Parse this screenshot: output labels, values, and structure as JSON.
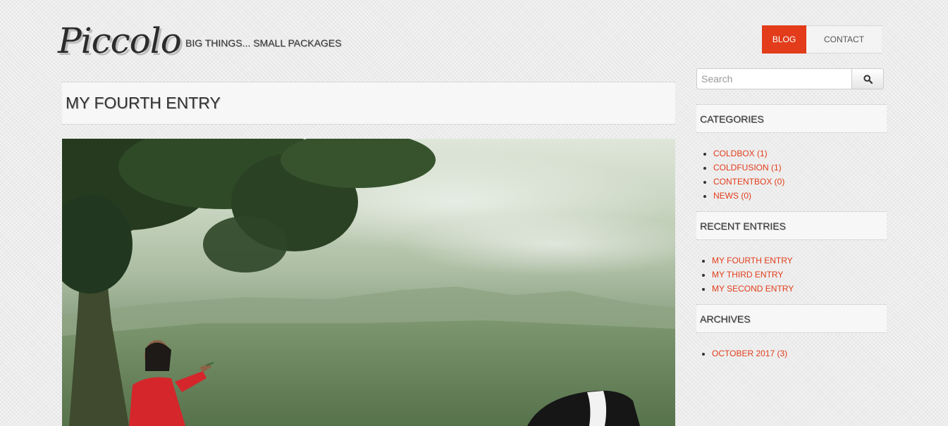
{
  "site": {
    "logo": "Piccolo",
    "tagline": "BIG THINGS... SMALL PACKAGES"
  },
  "nav": {
    "items": [
      {
        "label": "BLOG",
        "active": true
      },
      {
        "label": "CONTACT",
        "active": false
      }
    ],
    "accent_color": "#e23c1a"
  },
  "post": {
    "title": "MY FOURTH ENTRY"
  },
  "sidebar": {
    "search": {
      "placeholder": "Search",
      "icon": "search-icon"
    },
    "categories": {
      "title": "CATEGORIES",
      "items": [
        "COLDBOX (1)",
        "COLDFUSION (1)",
        "CONTENTBOX (0)",
        "NEWS (0)"
      ]
    },
    "recent": {
      "title": "RECENT ENTRIES",
      "items": [
        "MY FOURTH ENTRY",
        "MY THIRD ENTRY",
        "MY SECOND ENTRY"
      ]
    },
    "archives": {
      "title": "ARCHIVES",
      "items": [
        "OCTOBER 2017 (3)"
      ]
    }
  }
}
